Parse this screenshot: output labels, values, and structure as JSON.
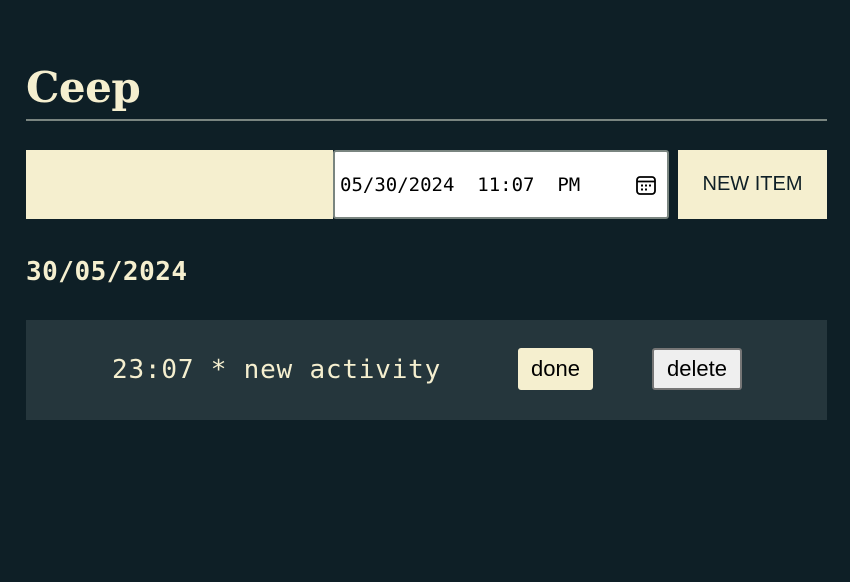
{
  "header": {
    "title": "Ceep"
  },
  "form": {
    "text_input": {
      "value": "",
      "placeholder": ""
    },
    "datetime_input": {
      "value": "05/30/2024  11:07  PM",
      "icon": "calendar-icon"
    },
    "new_item_label": "NEW ITEM"
  },
  "groups": [
    {
      "date": "30/05/2024",
      "items": [
        {
          "text": "23:07 * new activity",
          "done_label": "done",
          "delete_label": "delete"
        }
      ]
    }
  ],
  "colors": {
    "background": "#0e1f26",
    "card": "#25363c",
    "cream": "#f5efcf",
    "divider": "#7a8580"
  }
}
